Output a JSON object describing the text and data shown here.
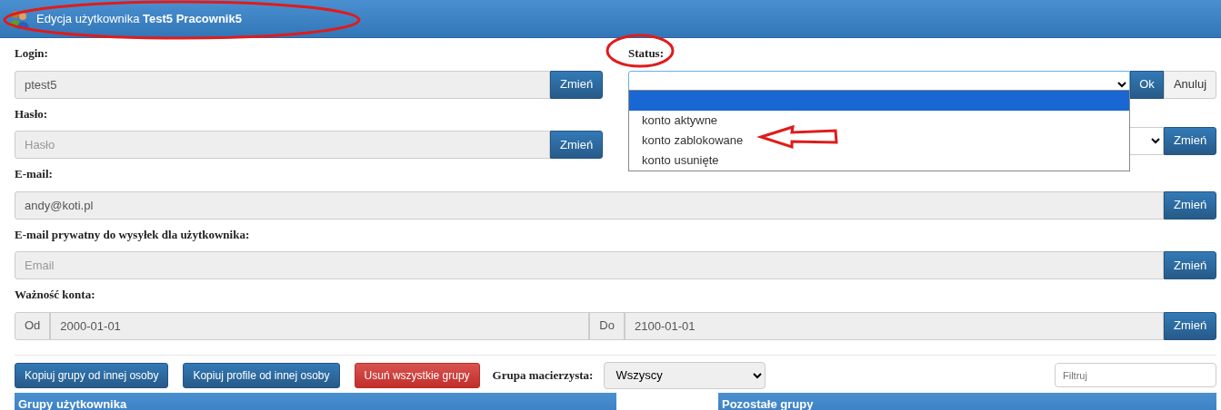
{
  "header": {
    "title": "Edycja użytkownika **Test5 Pracownik5**"
  },
  "login": {
    "label": "Login:",
    "value": "ptest5",
    "button": "Zmień"
  },
  "password": {
    "label": "Hasło:",
    "placeholder": "Hasło",
    "button": "Zmień"
  },
  "status": {
    "label": "Status:",
    "ok_button": "Ok",
    "cancel_button": "Anuluj",
    "expanded": true,
    "options": [
      {
        "selected": true
      },
      {
        "label": "konto aktywne",
        "selected": false
      },
      {
        "label": "konto zablokowane",
        "selected": false
      },
      {
        "label": "konto usunięte",
        "selected": false
      }
    ]
  },
  "status_row2": {
    "button": "Zmień"
  },
  "email": {
    "label": "E-mail:",
    "value": "andy@koti.pl",
    "button": "Zmień"
  },
  "private_email": {
    "label": "E-mail prywatny do wysyłek dla użytkownika:",
    "placeholder": "Email",
    "button": "Zmień"
  },
  "validity": {
    "label": "Ważność konta:",
    "from_label": "Od",
    "from": "2000-01-01",
    "to_label": "Do",
    "to": "2100-01-01",
    "button": "Zmień"
  },
  "actions": [
    {
      "label": "Kopiuj grupy od innej osoby",
      "kind": "primary"
    },
    {
      "label": "Kopiuj profile od innej osoby",
      "kind": "primary"
    },
    {
      "label": "Usuń wszystkie grupy",
      "kind": "danger"
    }
  ],
  "parent_group": {
    "label": "Grupa macierzysta:",
    "value": "Wszyscy"
  },
  "filter": {
    "placeholder": "Filtruj"
  },
  "panels": [
    {
      "title": "Grupy użytkownika"
    },
    {
      "title": "Pozostałe grupy"
    }
  ],
  "annotations": [
    {
      "kind": "ellipse"
    },
    {
      "kind": "ellipse"
    },
    {
      "kind": "arrow"
    }
  ]
}
